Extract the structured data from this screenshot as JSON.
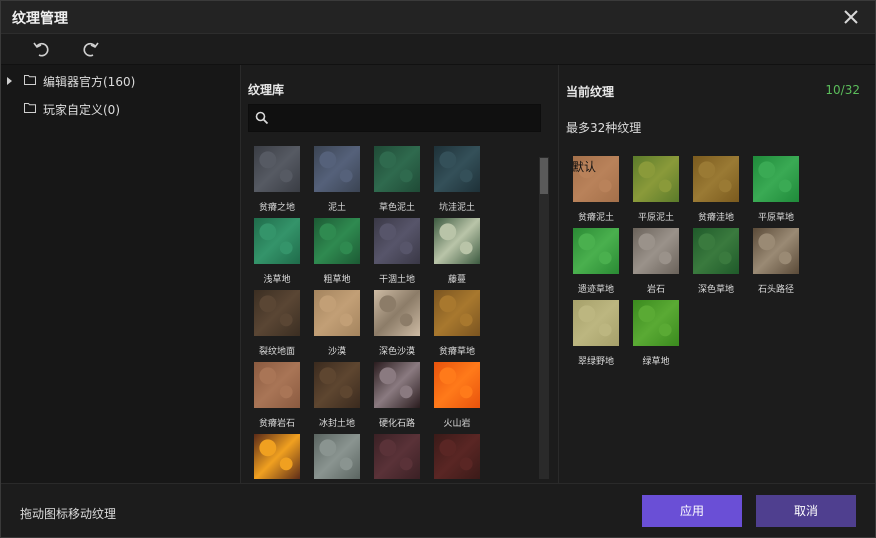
{
  "window": {
    "title": "纹理管理"
  },
  "tree": [
    {
      "label": "编辑器官方(160)",
      "expandable": true
    },
    {
      "label": "玩家自定义(0)",
      "expandable": false
    }
  ],
  "library": {
    "title": "纹理库",
    "search_placeholder": "",
    "items": [
      {
        "label": "贫瘠之地",
        "color": "#3a3d44",
        "accent": "#565a63"
      },
      {
        "label": "泥土",
        "color": "#3b4453",
        "accent": "#55617a"
      },
      {
        "label": "草色泥土",
        "color": "#1f4a36",
        "accent": "#2f6a4e"
      },
      {
        "label": "坑洼泥土",
        "color": "#1e3138",
        "accent": "#345059"
      },
      {
        "label": "浅草地",
        "color": "#1f6b4a",
        "accent": "#34946a"
      },
      {
        "label": "粗草地",
        "color": "#1c5a34",
        "accent": "#2f8a50"
      },
      {
        "label": "干涸土地",
        "color": "#3a3846",
        "accent": "#57556a"
      },
      {
        "label": "藤蔓",
        "color": "#3c5a40",
        "accent": "#b9c4a8"
      },
      {
        "label": "裂纹地面",
        "color": "#3b2e22",
        "accent": "#5a4634"
      },
      {
        "label": "沙漠",
        "color": "#a4845e",
        "accent": "#c29f76"
      },
      {
        "label": "深色沙漠",
        "color": "#cdbba4",
        "accent": "#8c7c68"
      },
      {
        "label": "贫瘠草地",
        "color": "#7a5420",
        "accent": "#a8782e"
      },
      {
        "label": "贫瘠岩石",
        "color": "#8a5a40",
        "accent": "#a97556"
      },
      {
        "label": "冰封土地",
        "color": "#3a2a1e",
        "accent": "#5e4630"
      },
      {
        "label": "硬化石路",
        "color": "#2a1c1e",
        "accent": "#8a7a80"
      },
      {
        "label": "火山岩",
        "color": "#e8520c",
        "accent": "#ff7a1a"
      },
      {
        "label": "",
        "color": "#5a2a18",
        "accent": "#f0a020"
      },
      {
        "label": "",
        "color": "#5a6460",
        "accent": "#8a9490"
      },
      {
        "label": "",
        "color": "#3a2024",
        "accent": "#5a3238"
      },
      {
        "label": "",
        "color": "#3a1a18",
        "accent": "#5a2624"
      }
    ]
  },
  "current": {
    "title": "当前纹理",
    "count": "10/32",
    "subtitle": "最多32种纹理",
    "default_tag": "默认",
    "items": [
      {
        "label": "贫瘠泥土",
        "color": "#a4704a",
        "accent": "#b9825a"
      },
      {
        "label": "平原泥土",
        "color": "#5a7a2a",
        "accent": "#8a9a3a"
      },
      {
        "label": "贫瘠洼地",
        "color": "#7a5a1e",
        "accent": "#9a7a34"
      },
      {
        "label": "平原草地",
        "color": "#1f8a3a",
        "accent": "#3aaa54"
      },
      {
        "label": "遗迹草地",
        "color": "#2a8a34",
        "accent": "#4ab04e"
      },
      {
        "label": "岩石",
        "color": "#6a625a",
        "accent": "#9a928a"
      },
      {
        "label": "深色草地",
        "color": "#1f5a2a",
        "accent": "#3a7a3e"
      },
      {
        "label": "石头路径",
        "color": "#5a4a38",
        "accent": "#9a8a74"
      },
      {
        "label": "翠绿野地",
        "color": "#a6a06a",
        "accent": "#bcb680"
      },
      {
        "label": "绿草地",
        "color": "#3a8a1e",
        "accent": "#5aaa34"
      }
    ]
  },
  "footer": {
    "hint": "拖动图标移动纹理",
    "apply_label": "应用",
    "cancel_label": "取消"
  }
}
